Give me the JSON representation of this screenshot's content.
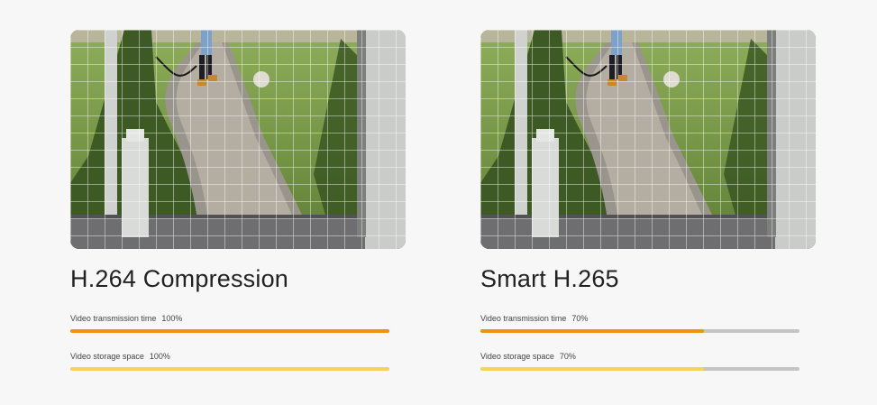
{
  "panels": [
    {
      "title": "H.264 Compression",
      "metrics": [
        {
          "label": "Video transmission time",
          "value_text": "100%",
          "fraction": 1.0,
          "color": "#f0920e"
        },
        {
          "label": "Video storage space",
          "value_text": "100%",
          "fraction": 1.0,
          "color": "#f7d35a"
        }
      ]
    },
    {
      "title": "Smart H.265",
      "metrics": [
        {
          "label": "Video transmission time",
          "value_text": "70%",
          "fraction": 0.7,
          "color": "#f0920e"
        },
        {
          "label": "Video storage space",
          "value_text": "70%",
          "fraction": 0.7,
          "color": "#f7d35a"
        }
      ]
    }
  ],
  "colors": {
    "track": "#c4c4c4",
    "background": "#f7f7f7",
    "title_text": "#222222"
  }
}
